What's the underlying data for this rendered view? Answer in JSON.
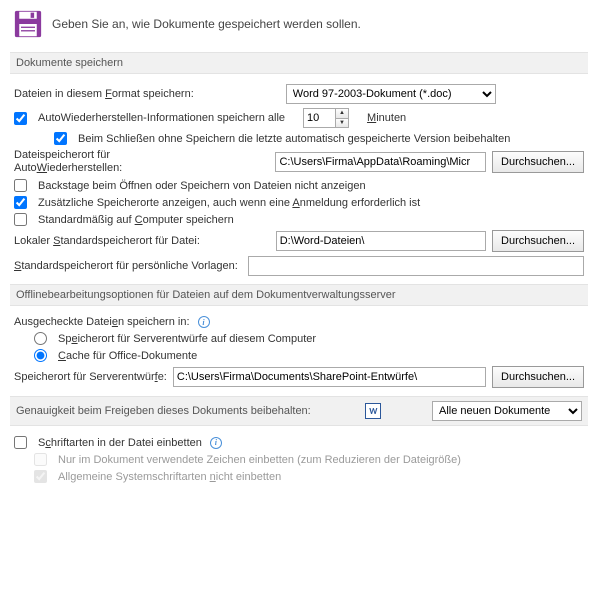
{
  "header": {
    "text": "Geben Sie an, wie Dokumente gespeichert werden sollen."
  },
  "sections": {
    "save": {
      "title": "Dokumente speichern"
    },
    "offline": {
      "title": "Offlinebearbeitungsoptionen für Dateien auf dem Dokumentverwaltungsserver"
    },
    "fidelity": {
      "title": "Genauigkeit beim Freigeben dieses Dokuments beibehalten:"
    }
  },
  "save": {
    "formatLabelPre": "Dateien in diesem ",
    "formatLabelUL": "F",
    "formatLabelPost": "ormat speichern:",
    "formatValue": "Word 97-2003-Dokument (*.doc)",
    "autoRecoverLabel": "AutoWiederherstellen-Informationen speichern alle",
    "autoRecoverMinutes": "10",
    "minutesLabelUL": "M",
    "minutesLabelPost": "inuten",
    "keepLastLabel": "Beim Schließen ohne Speichern die letzte automatisch gespeicherte Version beibehalten",
    "autoRecoverPathLabel1": "Dateispeicherort für",
    "autoRecoverPathLabel2Pre": "Auto",
    "autoRecoverPathLabel2UL": "W",
    "autoRecoverPathLabel2Post": "iederherstellen:",
    "autoRecoverPath": "C:\\Users\\Firma\\AppData\\Roaming\\Micr",
    "backstageLabel": "Backstage beim Öffnen oder Speichern von Dateien nicht anzeigen",
    "extraLocationsLabelPre": "Zusätzliche Speicherorte anzeigen, auch wenn eine ",
    "extraLocationsLabelUL": "A",
    "extraLocationsLabelPost": "nmeldung erforderlich ist",
    "defaultComputerLabelPre": "Standardmäßig auf ",
    "defaultComputerLabelUL": "C",
    "defaultComputerLabelPost": "omputer speichern",
    "localDefaultLabelPre": "Lokaler ",
    "localDefaultLabelUL": "S",
    "localDefaultLabelPost": "tandardspeicherort für Datei:",
    "localDefaultPath": "D:\\Word-Dateien\\",
    "templateLabelUL": "S",
    "templateLabelPost": "tandardspeicherort für persönliche Vorlagen:",
    "templatePath": ""
  },
  "offline": {
    "checkoutLabelPre": "Ausgecheckte Datei",
    "checkoutLabelUL": "e",
    "checkoutLabelPost": "n speichern in:",
    "radioServerPre": "Sp",
    "radioServerUL": "e",
    "radioServerPost": "icherort für Serverentwürfe auf diesem Computer",
    "radioCacheUL": "C",
    "radioCachePost": "ache für Office-Dokumente",
    "draftPathLabelPre": "Speicherort für Serverentwür",
    "draftPathLabelUL": "f",
    "draftPathLabelPost": "e:",
    "draftPath": "C:\\Users\\Firma\\Documents\\SharePoint-Entwürfe\\"
  },
  "fidelity": {
    "docSelectValue": "Alle neuen Dokumente",
    "embedFontsLabelPre": "S",
    "embedFontsLabelUL": "c",
    "embedFontsLabelPost": "hriftarten in der Datei einbetten",
    "subsetLabel": "Nur im Dokument verwendete Zeichen einbetten (zum Reduzieren der Dateigröße)",
    "commonFontsLabelPre": "Allgemeine Systemschriftarten ",
    "commonFontsLabelUL": "n",
    "commonFontsLabelPost": "icht einbetten"
  },
  "buttons": {
    "browse": "Durchsuchen..."
  },
  "icons": {
    "wordLetter": "W"
  }
}
